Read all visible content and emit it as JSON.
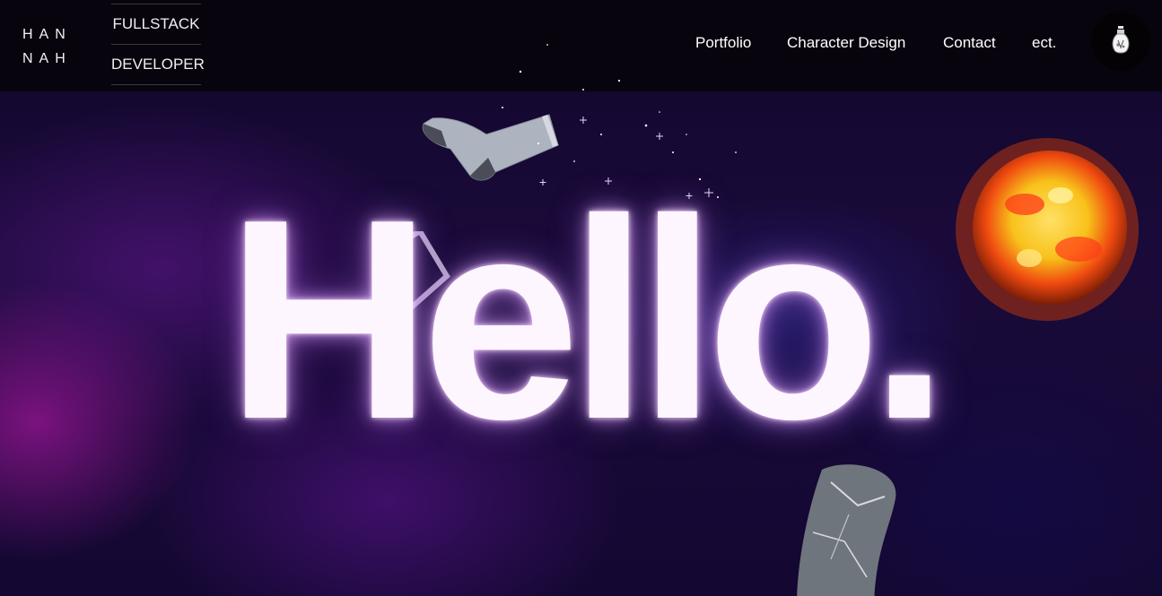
{
  "header": {
    "logo_line1": "HAN",
    "logo_line2": "NAH",
    "role_line1": "FULLSTACK",
    "role_line2": "DEVELOPER",
    "nav": [
      {
        "label": "Portfolio"
      },
      {
        "label": "Character Design"
      },
      {
        "label": "Contact"
      },
      {
        "label": "ect."
      }
    ],
    "theme_icon": "lightbulb-icon"
  },
  "hero": {
    "headline": "Hello.",
    "decorations": [
      "sock-image",
      "sun-image",
      "rock-image",
      "picture-frame-image",
      "stars-image"
    ]
  },
  "colors": {
    "header_bg": "#08040c",
    "headline": "#fdf6ff",
    "glow": "#c88cff",
    "background": "#140832"
  }
}
